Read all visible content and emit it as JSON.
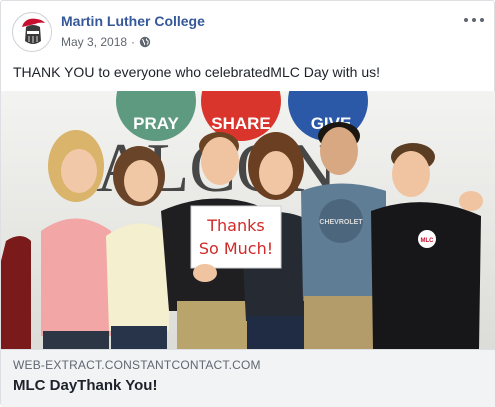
{
  "post": {
    "page_name": "Martin Luther College",
    "date": "May 3, 2018",
    "separator": "·",
    "privacy_icon": "globe-icon",
    "menu_icon": "more-options-icon",
    "text": "THANK YOU to everyone who celebratedMLC Day with us!"
  },
  "photo": {
    "circle_labels": [
      "PRAY",
      "SHARE",
      "GIVE"
    ],
    "sign_line_1": "Thanks",
    "sign_line_2": "So Much!",
    "shirt_text": "CHEVROLET",
    "patch_text": "MLC"
  },
  "link": {
    "domain": "WEB-EXTRACT.CONSTANTCONTACT.COM",
    "title": "MLC DayThank You!"
  },
  "colors": {
    "link_blue": "#365899",
    "pray_green": "#5d9a80",
    "share_red": "#d9352c",
    "give_blue": "#2b59a8"
  }
}
